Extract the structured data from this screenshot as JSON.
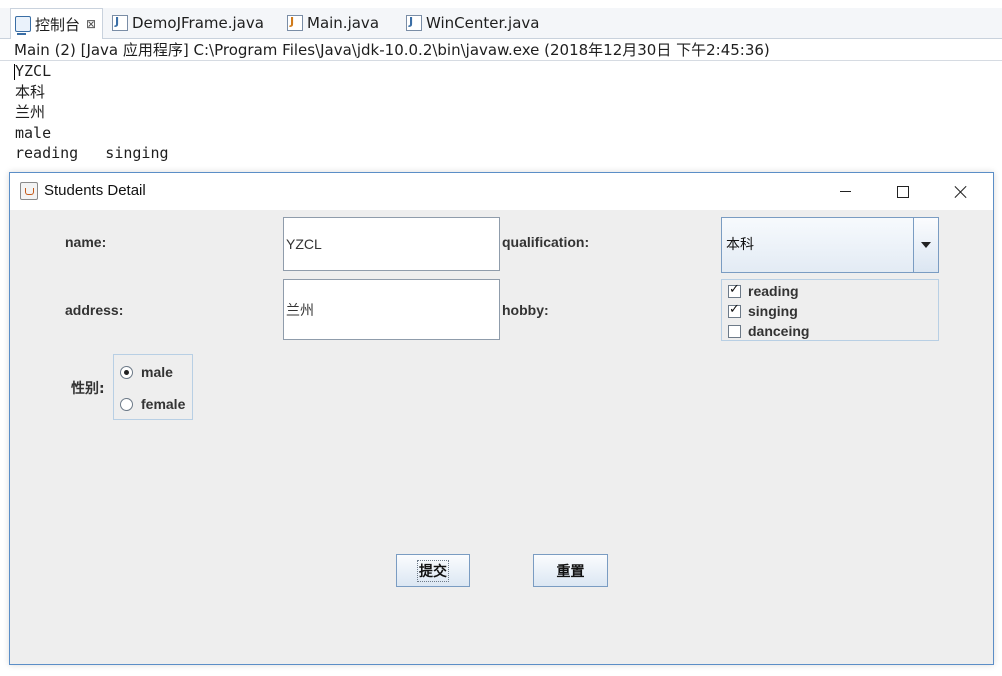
{
  "eclipse": {
    "tabs": [
      {
        "label": "控制台",
        "close": "⊠"
      },
      {
        "label": "DemoJFrame.java"
      },
      {
        "label": "Main.java"
      },
      {
        "label": "WinCenter.java"
      }
    ],
    "console_header": "Main (2)  [Java 应用程序] C:\\Program Files\\Java\\jdk-10.0.2\\bin\\javaw.exe (2018年12月30日 下午2:45:36)",
    "console_lines": [
      "YZCL",
      "本科",
      "兰州",
      "male",
      "reading   singing"
    ]
  },
  "window": {
    "title": "Students Detail",
    "labels": {
      "name": "name:",
      "qualification": "qualification:",
      "address": "address:",
      "hobby": "hobby:",
      "gender": "性别:"
    },
    "name_value": "YZCL",
    "address_value": "兰州",
    "qualification_selected": "本科",
    "hobbies": [
      {
        "label": "reading",
        "checked": true
      },
      {
        "label": "singing",
        "checked": true
      },
      {
        "label": "danceing",
        "checked": false
      }
    ],
    "genders": [
      {
        "label": "male",
        "selected": true
      },
      {
        "label": "female",
        "selected": false
      }
    ],
    "submit_label": "提交",
    "reset_label": "重置"
  }
}
